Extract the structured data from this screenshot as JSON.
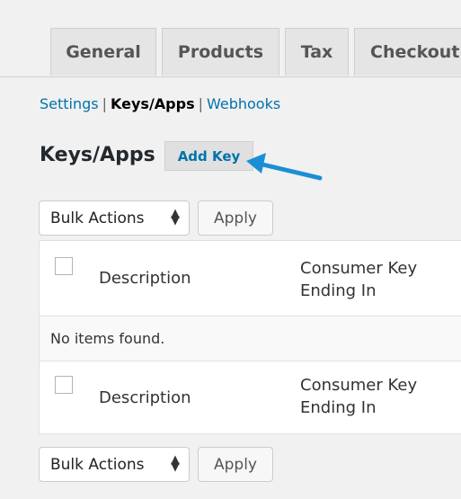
{
  "tabs": [
    {
      "label": "General"
    },
    {
      "label": "Products"
    },
    {
      "label": "Tax"
    },
    {
      "label": "Checkout"
    }
  ],
  "subnav": {
    "settings": "Settings",
    "keys_apps": "Keys/Apps",
    "webhooks": "Webhooks",
    "separator": "|"
  },
  "page": {
    "title": "Keys/Apps",
    "add_key_label": "Add Key"
  },
  "toolbar": {
    "bulk_actions": "Bulk Actions",
    "apply_label": "Apply"
  },
  "table": {
    "columns": {
      "description": "Description",
      "consumer_key_line1": "Consumer Key",
      "consumer_key_line2": "Ending In"
    },
    "empty_message": "No items found."
  },
  "colors": {
    "link": "#0073aa",
    "arrow": "#1a8fd6",
    "background": "#f1f1f1"
  }
}
